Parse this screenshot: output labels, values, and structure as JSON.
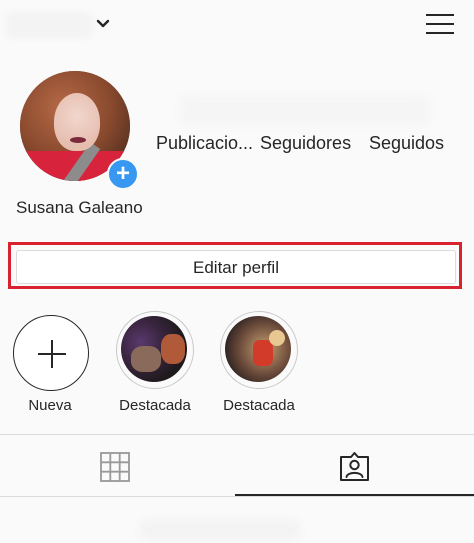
{
  "header": {
    "chevron_icon": "chevron-down-icon",
    "menu_icon": "hamburger-menu-icon"
  },
  "profile": {
    "name": "Susana Galeano",
    "add_icon": "plus-icon",
    "avatar_colors": {
      "shirt": "#d8233c",
      "hair": "#8a4a2e"
    }
  },
  "stats": {
    "posts_label": "Publicacio...",
    "followers_label": "Seguidores",
    "following_label": "Seguidos"
  },
  "edit_profile": {
    "label": "Editar perfil",
    "highlight_color": "#d92230"
  },
  "highlights": [
    {
      "label": "Nueva",
      "icon": "plus-icon"
    },
    {
      "label": "Destacada"
    },
    {
      "label": "Destacada"
    }
  ],
  "tabs": [
    {
      "name": "grid",
      "icon": "grid-icon",
      "active": false
    },
    {
      "name": "tagged",
      "icon": "person-tag-icon",
      "active": true
    }
  ],
  "colors": {
    "accent_blue": "#3897f0",
    "text": "#262626",
    "border": "#dbdbdb"
  }
}
